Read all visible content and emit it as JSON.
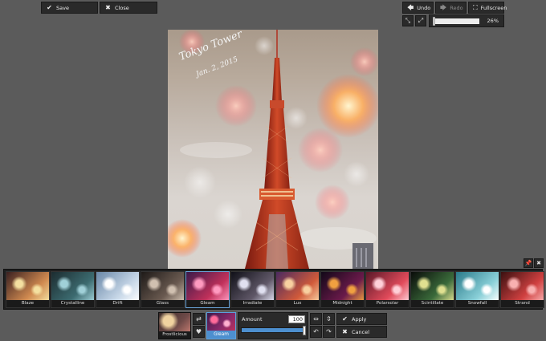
{
  "toolbar": {
    "save_label": "Save",
    "close_label": "Close",
    "undo_label": "Undo",
    "redo_label": "Redo",
    "fullscreen_label": "Fullscreen"
  },
  "zoom": {
    "label": "26%",
    "percent": 26
  },
  "photo": {
    "caption_title": "Tokyo Tower",
    "caption_date": "Jan. 2, 2015"
  },
  "filters": [
    {
      "label": "Blaze",
      "colors": [
        "#3a2020",
        "#d08a50",
        "#f4e0a0"
      ]
    },
    {
      "label": "Crystalline",
      "colors": [
        "#1c2c30",
        "#3c6b70",
        "#a0d0d8"
      ]
    },
    {
      "label": "Drift",
      "colors": [
        "#6a88a8",
        "#c8d8e8",
        "#ffffff"
      ]
    },
    {
      "label": "Glass",
      "colors": [
        "#1e1a18",
        "#6a5a50",
        "#d0c0b0"
      ]
    },
    {
      "label": "Gleam",
      "colors": [
        "#3b1a4a",
        "#c0305a",
        "#ff9ac0"
      ]
    },
    {
      "label": "Irradiate",
      "colors": [
        "#101018",
        "#605868",
        "#e0e0f0"
      ]
    },
    {
      "label": "Lux",
      "colors": [
        "#4a2a60",
        "#d05a3a",
        "#f8d0a0"
      ]
    },
    {
      "label": "Midnight",
      "colors": [
        "#120818",
        "#6a1a4a",
        "#f0a040"
      ]
    },
    {
      "label": "Polarsolar",
      "colors": [
        "#5a1828",
        "#e04a5a",
        "#ffd0d8"
      ]
    },
    {
      "label": "Scintillate",
      "colors": [
        "#0a0c0a",
        "#3a6a3a",
        "#e0e090"
      ]
    },
    {
      "label": "Snowfall",
      "colors": [
        "#2a7a8a",
        "#8ad0d8",
        "#ffffff"
      ]
    },
    {
      "label": "Strand",
      "colors": [
        "#3a1010",
        "#d04040",
        "#f8b0b0"
      ]
    }
  ],
  "selected_filter": "Gleam",
  "preset": {
    "label": "Frostlicious"
  },
  "active_filter": {
    "label": "Gleam"
  },
  "amount": {
    "label": "Amount",
    "value": "100",
    "percent": 100
  },
  "actions": {
    "apply_label": "Apply",
    "cancel_label": "Cancel"
  }
}
